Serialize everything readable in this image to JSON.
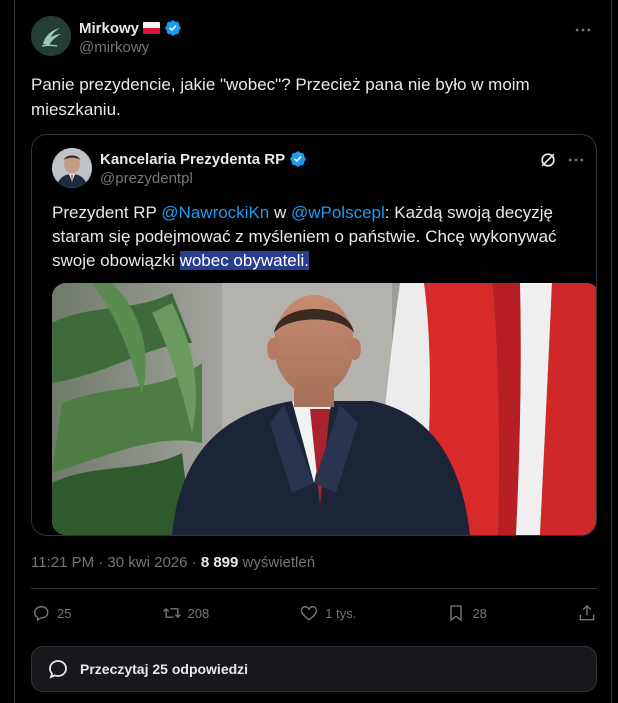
{
  "author": {
    "name": "Mirkowy",
    "handle": "@mirkowy"
  },
  "tweet": {
    "text": "Panie prezydencie, jakie \"wobec\"? Przecież pana nie było w moim mieszkaniu."
  },
  "quoted": {
    "name": "Kancelaria Prezydenta RP",
    "handle": "@prezydentpl",
    "text_1": "Prezydent RP ",
    "mention_1": "@NawrockiKn",
    "text_2": " w ",
    "mention_2": "@wPolscepl",
    "text_3": ": Każdą swoją decyzję staram się podejmować z myśleniem o państwie. Chcę wykonywać swoje obowiązki ",
    "highlight": "wobec obywateli."
  },
  "meta": {
    "time_date": "11:21 PM · 30 kwi 2026 · ",
    "views_count": "8 899",
    "views_label": " wyświetleń"
  },
  "actions": {
    "replies": "25",
    "reposts": "208",
    "likes": "1 tys.",
    "bookmarks": "28"
  },
  "read_replies": {
    "label": "Przeczytaj 25 odpowiedzi"
  },
  "colors": {
    "accent": "#1d9bf0",
    "background": "#000000",
    "border": "#2f3336",
    "muted": "#71767b",
    "highlight": "#2a3c8e"
  },
  "icons": [
    "more-icon",
    "verified-badge-icon",
    "flag-icon",
    "grok-icon",
    "reply-icon",
    "repost-icon",
    "like-icon",
    "bookmark-icon",
    "share-icon",
    "chat-bubble-icon"
  ]
}
